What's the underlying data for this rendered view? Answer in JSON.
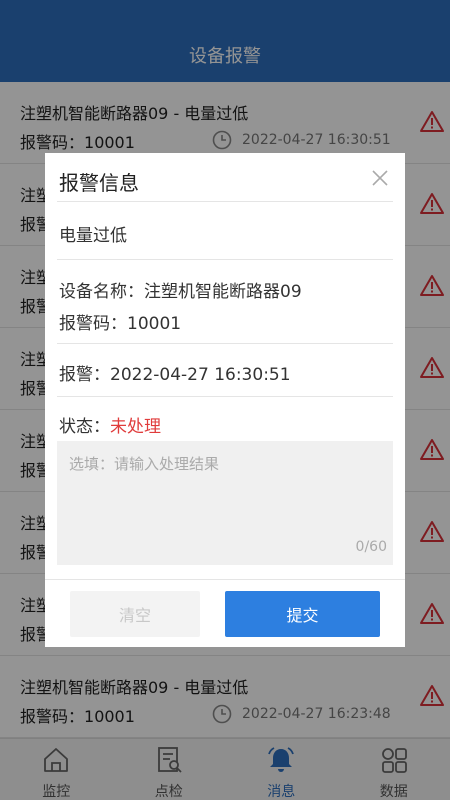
{
  "header": {
    "title": "设备报警"
  },
  "alarms": [
    {
      "title": "注塑机智能断路器09 - 电量过低",
      "code_label": "报警码：",
      "code": "10001",
      "time": "2022-04-27 16:30:51"
    },
    {
      "title": "注塑",
      "code_label": "报警",
      "code": "",
      "time": ""
    },
    {
      "title": "注塑",
      "code_label": "报警",
      "code": "",
      "time": ""
    },
    {
      "title": "注塑",
      "code_label": "报警",
      "code": "",
      "time": ""
    },
    {
      "title": "注塑",
      "code_label": "报警",
      "code": "",
      "time": ""
    },
    {
      "title": "注塑",
      "code_label": "报警",
      "code": "",
      "time": ""
    },
    {
      "title": "注塑",
      "code_label": "报警",
      "code": "",
      "time": ""
    },
    {
      "title": "注塑机智能断路器09 - 电量过低",
      "code_label": "报警码：",
      "code": "10001",
      "time": "2022-04-27 16:23:48"
    }
  ],
  "modal": {
    "title": "报警信息",
    "alarm_type": "电量过低",
    "device_label": "设备名称：",
    "device_name": "注塑机智能断路器09",
    "code_label": "报警码：",
    "code": "10001",
    "alarm_time_label": "报警：",
    "alarm_time": "2022-04-27 16:30:51",
    "status_label": "状态：",
    "status_value": "未处理",
    "input_placeholder": "选填：请输入处理结果",
    "input_value": "",
    "char_count": "0/60",
    "clear_label": "清空",
    "submit_label": "提交"
  },
  "tabs": [
    {
      "label": "监控",
      "icon": "home-icon",
      "active": false
    },
    {
      "label": "点检",
      "icon": "inspect-icon",
      "active": false
    },
    {
      "label": "消息",
      "icon": "bell-icon",
      "active": true
    },
    {
      "label": "数据",
      "icon": "grid-icon",
      "active": false
    }
  ],
  "colors": {
    "primary": "#2d6fbe",
    "warning": "#d9313a",
    "status_unhandled": "#e03c3c",
    "submit": "#2d7fe0"
  }
}
